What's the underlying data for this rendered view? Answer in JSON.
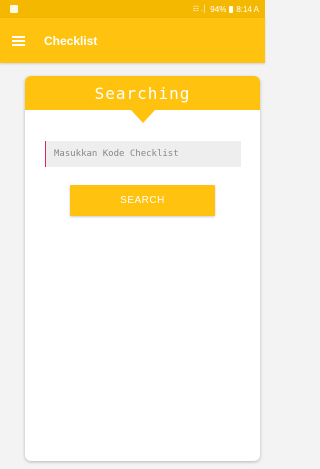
{
  "status_bar": {
    "signal": "☷ .│",
    "battery": "94%",
    "time": "8:14 A"
  },
  "app_bar": {
    "title": "Checklist"
  },
  "card": {
    "banner_title": "Searching",
    "search_input": {
      "placeholder": "Masukkan Kode Checklist",
      "value": ""
    },
    "search_button_label": "SEARCH"
  },
  "colors": {
    "accent": "#ffc20e",
    "status_bar": "#f5b800",
    "background": "#f3f3f3"
  }
}
